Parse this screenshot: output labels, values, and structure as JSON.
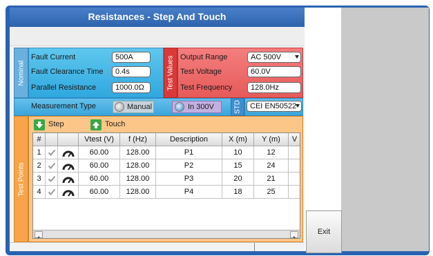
{
  "window": {
    "title": "Resistances - Step And Touch"
  },
  "nominal": {
    "tab_label": "Nominal",
    "fault_current_label": "Fault Current",
    "fault_current_value": "500A",
    "fault_clearance_label": "Fault Clearance Time",
    "fault_clearance_value": "0.4s",
    "parallel_resistance_label": "Parallel Resistance",
    "parallel_resistance_value": "1000.0Ω"
  },
  "test_values": {
    "tab_label": "Test Values",
    "output_range_label": "Output Range",
    "output_range_value": "AC 500V",
    "test_voltage_label": "Test Voltage",
    "test_voltage_value": "60.0V",
    "test_frequency_label": "Test Frequency",
    "test_frequency_value": "128.0Hz"
  },
  "measurement": {
    "label": "Measurement Type",
    "option_manual": "Manual",
    "option_in300": "In 300V",
    "selected": "In 300V"
  },
  "std": {
    "tab_label": "STD",
    "value": "CEI EN50522"
  },
  "test_points": {
    "tab_label": "Test Points",
    "step_label": "Step",
    "touch_label": "Touch",
    "columns": [
      "#",
      "",
      "",
      "Vtest (V)",
      "f (Hz)",
      "Description",
      "X (m)",
      "Y (m)",
      "V"
    ],
    "rows": [
      {
        "n": "1",
        "vtest": "60.00",
        "f": "128.00",
        "desc": "P1",
        "x": "10",
        "y": "12"
      },
      {
        "n": "2",
        "vtest": "60.00",
        "f": "128.00",
        "desc": "P2",
        "x": "15",
        "y": "24"
      },
      {
        "n": "3",
        "vtest": "60.00",
        "f": "128.00",
        "desc": "P3",
        "x": "20",
        "y": "21"
      },
      {
        "n": "4",
        "vtest": "60.00",
        "f": "128.00",
        "desc": "P4",
        "x": "18",
        "y": "25"
      }
    ]
  },
  "actions": {
    "exit_label": "Exit"
  },
  "colors": {
    "frame": "#2a62b0",
    "nominal": "#3aa5db",
    "test_values": "#e75a5a",
    "test_points": "#fbc688"
  }
}
